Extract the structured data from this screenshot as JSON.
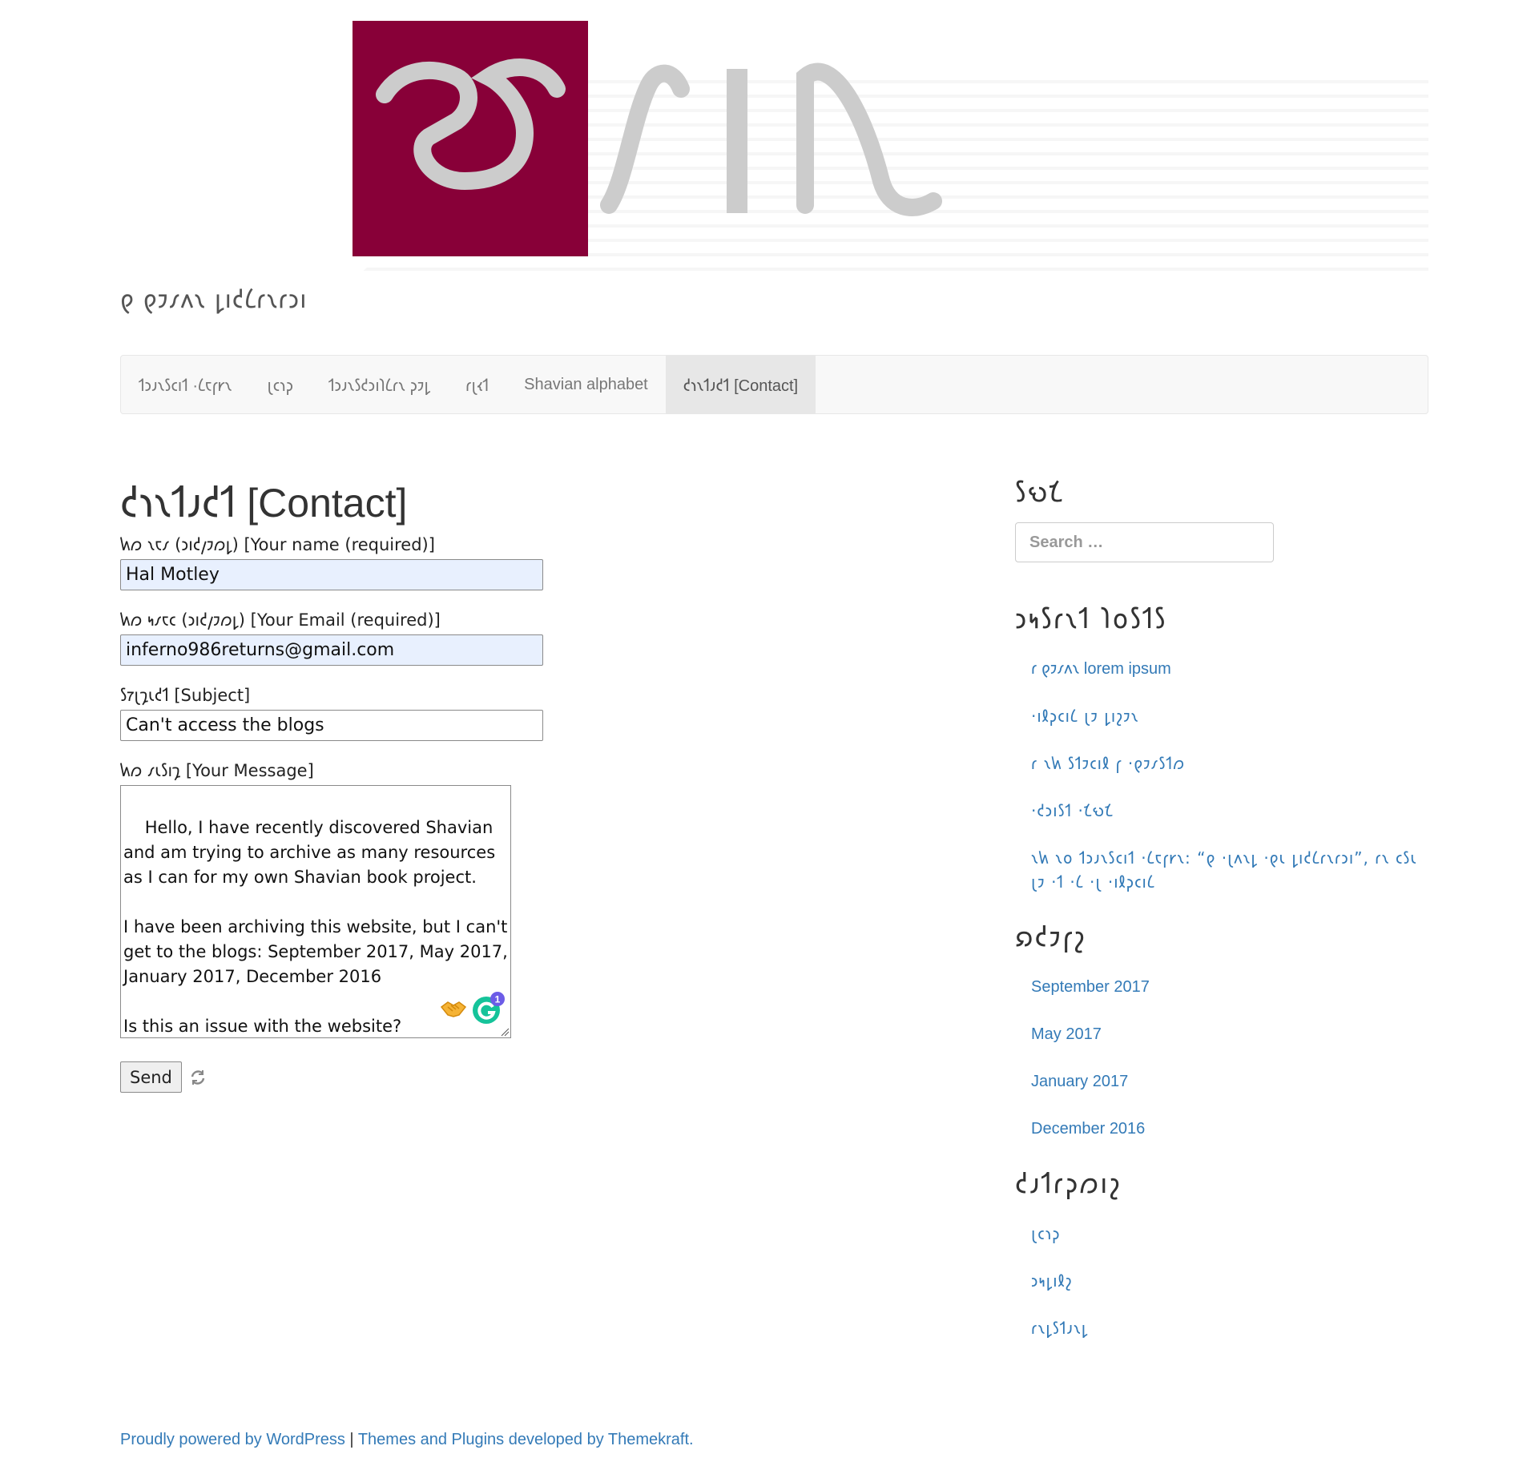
{
  "site": {
    "tagline": "𐑞 𐑞𐑲𐑥𐑵𐑯 𐑛𐑦𐑒𐑖𐑩𐑯𐑩𐑮𐑦"
  },
  "nav": {
    "items": [
      {
        "label": "𐑑𐑮𐑨𐑯𐑕𐑤𐑦𐑑 ·𐑖𐑱𐑝𐑾𐑯"
      },
      {
        "label": "𐑚𐑤𐑪𐑜"
      },
      {
        "label": "𐑑𐑮𐑨𐑯𐑕𐑒𐑮𐑦𐑐𐑖𐑩𐑯 𐑜𐑲𐑛"
      },
      {
        "label": "𐑩𐑚𐑬𐑑"
      },
      {
        "label": "Shavian alphabet"
      },
      {
        "label": "𐑒𐑪𐑯𐑑𐑨𐑒𐑑 [Contact]"
      }
    ]
  },
  "page": {
    "title": "𐑒𐑪𐑯𐑑𐑨𐑒𐑑 [Contact]"
  },
  "form": {
    "name_label": "𐑿𐑼 𐑯𐑱𐑥 (𐑮𐑦𐑒𐑢𐑲𐑼𐑛) [Your name (required)]",
    "name_value": "Hal Motley",
    "email_label": "𐑿𐑼 𐑰𐑥𐑱𐑤 (𐑮𐑦𐑒𐑢𐑲𐑼𐑛) [Your Email (required)]",
    "email_value": "inferno986returns@gmail.com",
    "subject_label": "𐑕𐑳𐑚𐑡𐑧𐑒𐑑 [Subject]",
    "subject_value": "Can't access the blogs",
    "message_label": "𐑿𐑼 𐑥𐑧𐑕𐑦𐑡 [Your Message]",
    "message_value": "Hello, I have recently discovered Shavian and am trying to archive as many resources as I can for my own Shavian book project.\n\nI have been archiving this website, but I can't get to the blogs: September 2017, May 2017, January 2017, December 2016\n\nIs this an issue with the website?",
    "grammarly_count": "1",
    "send_label": "Send"
  },
  "sidebar": {
    "search_title": "𐑕𐑻𐑗",
    "search_placeholder": "Search …",
    "recent_title": "𐑮𐑰𐑕𐑩𐑯𐑑 𐑐𐑴𐑕𐑑𐑕",
    "recent_posts": [
      "𐑩 𐑞𐑲𐑥𐑵𐑯 lorem ipsum",
      "·𐑦𐑙𐑜𐑤𐑦𐑖 𐑚𐑲 𐑛𐑦𐑟𐑲𐑯",
      "𐑩 𐑯𐑿 𐑕𐑑𐑲𐑤𐑦𐑙 𐑝 ·𐑞𐑲𐑥𐑕𐑑𐑼",
      "·𐑒𐑮𐑦𐑕𐑑 ·𐑗𐑻𐑗",
      "𐑯𐑿 𐑯𐑴 𐑑𐑮𐑨𐑯𐑕𐑤𐑦𐑑 ·𐑖𐑱𐑝𐑾𐑯: “𐑞 ·𐑚𐑵𐑯𐑛 ·𐑞𐑧 𐑛𐑦𐑒𐑖𐑩𐑯𐑩𐑮𐑦”, 𐑩𐑯 𐑤𐑕𐑧 𐑚𐑲 ·𐑑 ·𐑖 ·𐑚 ·𐑦𐑙𐑜𐑤𐑦𐑖"
    ],
    "archives_title": "𐑸𐑒𐑲𐑝𐑟",
    "archives": [
      "September 2017",
      "May 2017",
      "January 2017",
      "December 2016"
    ],
    "categories_title": "𐑒𐑨𐑑𐑩𐑜𐑼𐑦𐑟",
    "categories": [
      "𐑚𐑤𐑪𐑜",
      "𐑮𐑰𐑛𐑦𐑙𐑟",
      "𐑩𐑯𐑛𐑕𐑑𐑨𐑯𐑛"
    ]
  },
  "footer": {
    "powered": "Proudly powered by WordPress",
    "separator": " | ",
    "themes": "Themes and Plugins developed by Themekraft."
  },
  "colors": {
    "logo_square": "#880038",
    "logo_glyph": "#cccccc",
    "link": "#337ab7",
    "nav_active_bg": "#e7e7e7"
  },
  "icons": {
    "emoji": "handshake-icon",
    "grammarly": "grammarly-icon",
    "spinner": "refresh-spinner-icon",
    "resize": "resize-grip-icon"
  }
}
